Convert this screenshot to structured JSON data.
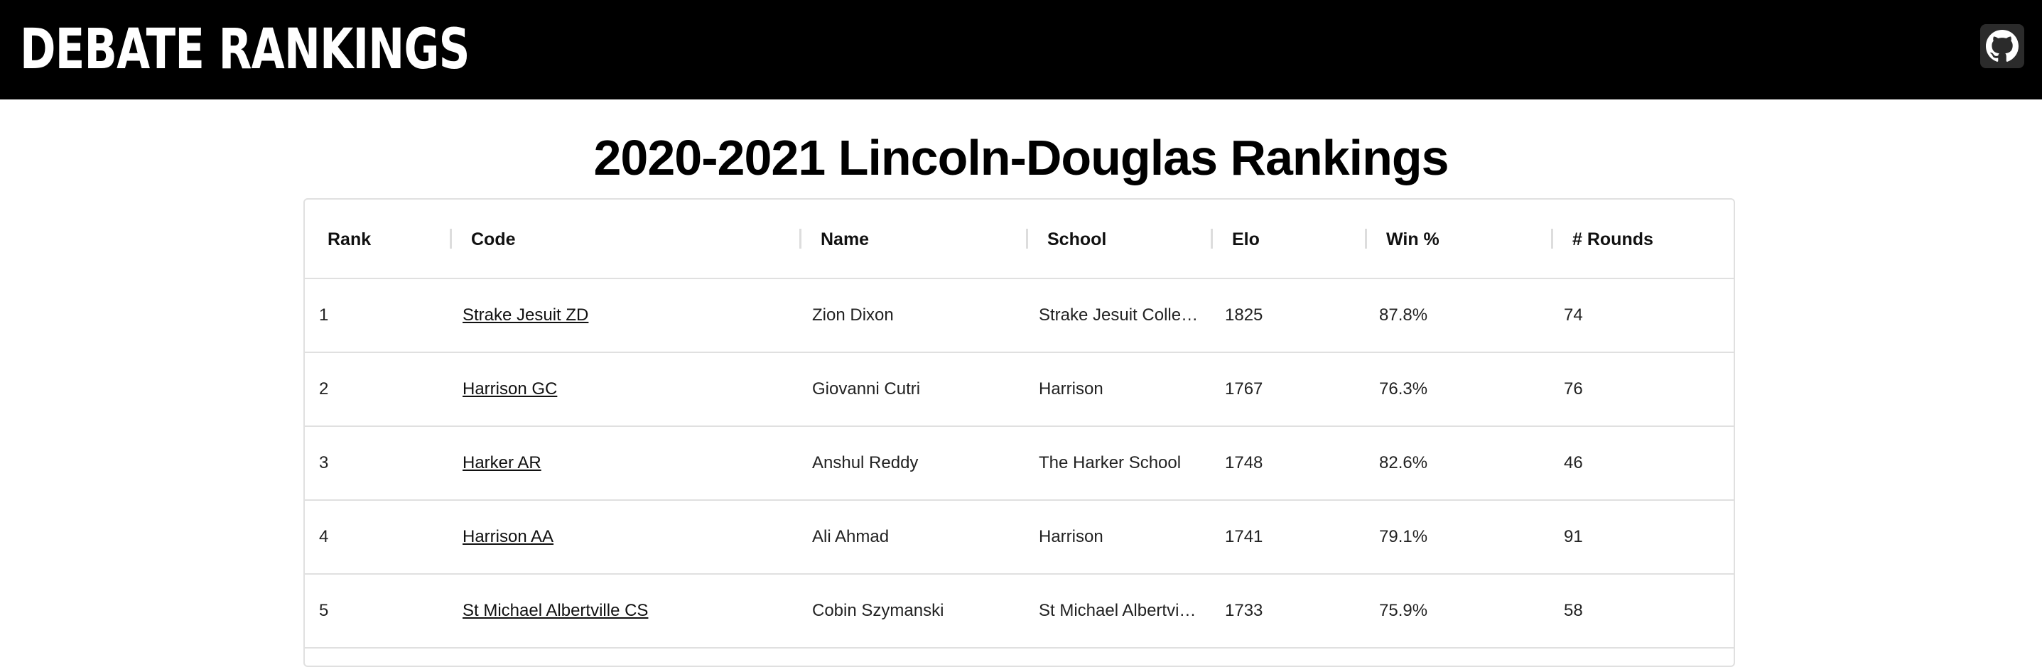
{
  "header": {
    "brand": "DEBATE RANKINGS",
    "github_icon": "github-icon"
  },
  "page": {
    "title": "2020-2021 Lincoln-Douglas Rankings"
  },
  "table": {
    "columns": [
      "Rank",
      "Code",
      "Name",
      "School",
      "Elo",
      "Win %",
      "# Rounds"
    ],
    "rows": [
      {
        "rank": "1",
        "code": "Strake Jesuit ZD",
        "name": "Zion Dixon",
        "school": "Strake Jesuit Colle…",
        "elo": "1825",
        "win": "87.8%",
        "rounds": "74"
      },
      {
        "rank": "2",
        "code": "Harrison GC",
        "name": "Giovanni Cutri",
        "school": "Harrison",
        "elo": "1767",
        "win": "76.3%",
        "rounds": "76"
      },
      {
        "rank": "3",
        "code": "Harker AR",
        "name": "Anshul Reddy",
        "school": "The Harker School",
        "elo": "1748",
        "win": "82.6%",
        "rounds": "46"
      },
      {
        "rank": "4",
        "code": "Harrison AA",
        "name": "Ali Ahmad",
        "school": "Harrison",
        "elo": "1741",
        "win": "79.1%",
        "rounds": "91"
      },
      {
        "rank": "5",
        "code": "St Michael Albertville CS",
        "name": "Cobin Szymanski",
        "school": "St Michael Albertvi…",
        "elo": "1733",
        "win": "75.9%",
        "rounds": "58"
      }
    ]
  },
  "colors": {
    "topbar": "#000000",
    "background": "#ffffff",
    "border": "#e0e0e0"
  }
}
